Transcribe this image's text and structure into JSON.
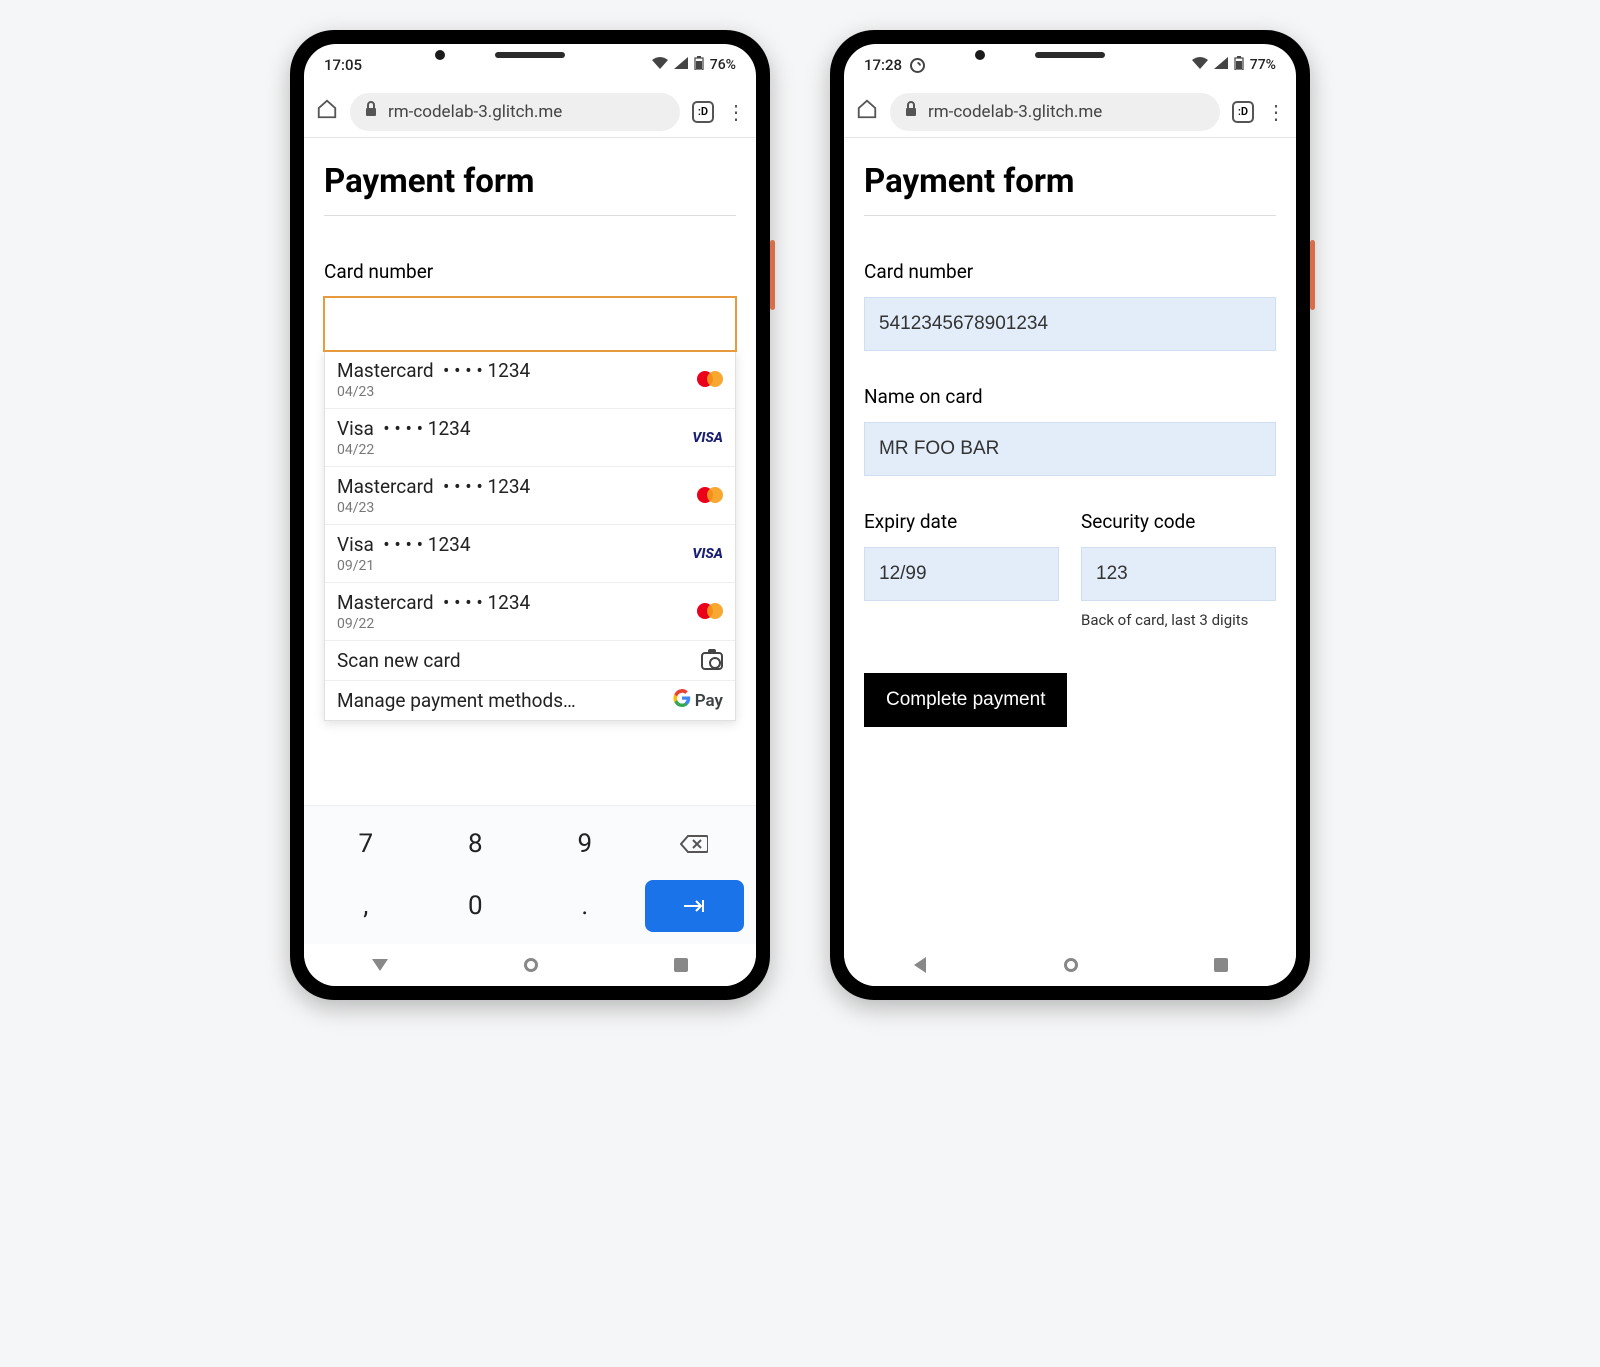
{
  "phone1": {
    "status": {
      "time": "17:05",
      "battery": "76%"
    },
    "url": "rm-codelab-3.glitch.me",
    "tab_count": ":D",
    "page_title": "Payment form",
    "card_number_label": "Card number",
    "card_number_value": "",
    "autofill": {
      "cards": [
        {
          "brand": "Mastercard",
          "masked": "• • • • 1234",
          "exp": "04/23",
          "icon": "mc"
        },
        {
          "brand": "Visa",
          "masked": "• • • • 1234",
          "exp": "04/22",
          "icon": "visa"
        },
        {
          "brand": "Mastercard",
          "masked": "• • • • 1234",
          "exp": "04/23",
          "icon": "mc"
        },
        {
          "brand": "Visa",
          "masked": "• • • • 1234",
          "exp": "09/21",
          "icon": "visa"
        },
        {
          "brand": "Mastercard",
          "masked": "• • • • 1234",
          "exp": "09/22",
          "icon": "mc"
        }
      ],
      "scan_label": "Scan new card",
      "manage_label": "Manage payment methods…",
      "gpay_label": "Pay"
    },
    "keys": [
      "7",
      "8",
      "9",
      "⌫",
      ",",
      "0",
      ".",
      "→|"
    ]
  },
  "phone2": {
    "status": {
      "time": "17:28",
      "battery": "77%"
    },
    "url": "rm-codelab-3.glitch.me",
    "tab_count": ":D",
    "page_title": "Payment form",
    "card_number_label": "Card number",
    "card_number_value": "5412345678901234",
    "name_label": "Name on card",
    "name_value": "MR FOO BAR",
    "expiry_label": "Expiry date",
    "expiry_value": "12/99",
    "cvc_label": "Security code",
    "cvc_value": "123",
    "cvc_help": "Back of card, last 3 digits",
    "submit_label": "Complete payment"
  }
}
